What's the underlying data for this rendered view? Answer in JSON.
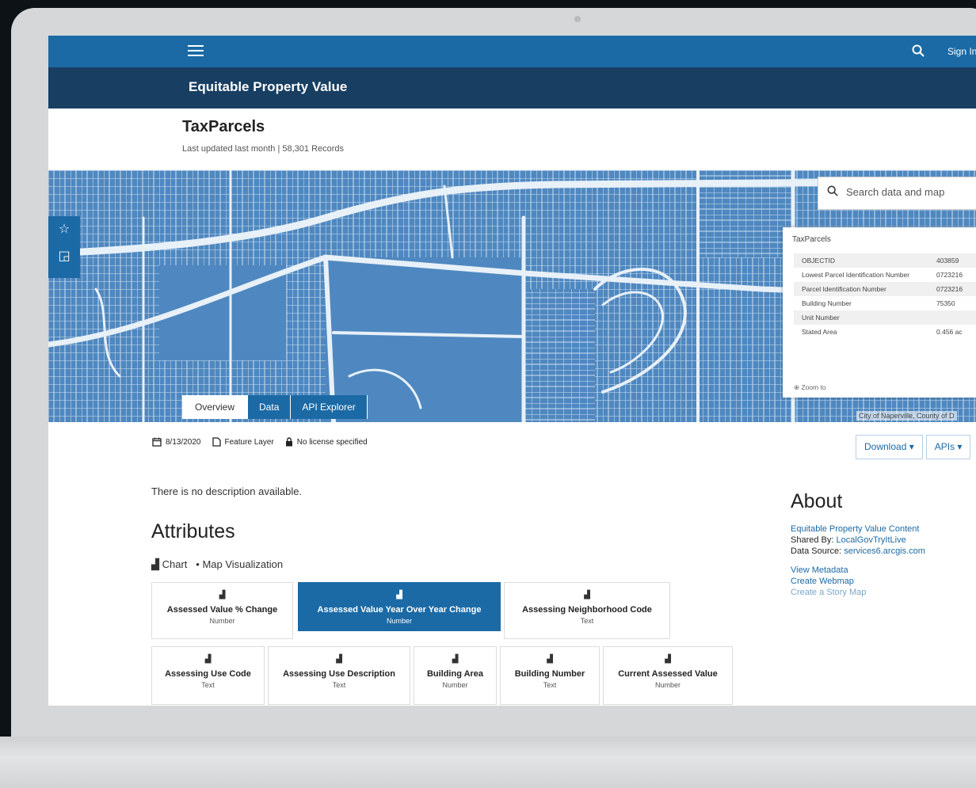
{
  "topbar": {
    "sign_in": "Sign In"
  },
  "site_title": "Equitable Property Value",
  "layer": {
    "name": "TaxParcels",
    "subtitle": "Last updated last month | 58,301 Records"
  },
  "map": {
    "search_placeholder": "Search data and map",
    "attribution": "City of Naperville, County of D",
    "popup": {
      "title": "TaxParcels",
      "rows": [
        {
          "field": "OBJECTID",
          "value": "403859"
        },
        {
          "field": "Lowest Parcel Identification Number",
          "value": "0723216"
        },
        {
          "field": "Parcel Identification Number",
          "value": "0723216"
        },
        {
          "field": "Building Number",
          "value": "75350"
        },
        {
          "field": "Unit Number",
          "value": ""
        },
        {
          "field": "Stated Area",
          "value": "0.456 ac"
        }
      ],
      "zoom_to": "Zoom to"
    }
  },
  "tabs": [
    "Overview",
    "Data",
    "API Explorer"
  ],
  "meta": {
    "date": "8/13/2020",
    "type": "Feature Layer",
    "license": "No license specified"
  },
  "buttons": {
    "download": "Download ▾",
    "apis": "APIs ▾"
  },
  "description": "There is no description available.",
  "attributes": {
    "heading": "Attributes",
    "legend_chart": "Chart",
    "legend_map": "Map Visualization",
    "cards": [
      {
        "label": "Assessed Value % Change",
        "type": "Number"
      },
      {
        "label": "Assessed Value Year Over Year Change",
        "type": "Number"
      },
      {
        "label": "Assessing Neighborhood Code",
        "type": "Text"
      },
      {
        "label": "Assessing Use Code",
        "type": "Text"
      },
      {
        "label": "Assessing Use Description",
        "type": "Text"
      },
      {
        "label": "Building Area",
        "type": "Number"
      },
      {
        "label": "Building Number",
        "type": "Text"
      },
      {
        "label": "Current Assessed Value",
        "type": "Number"
      }
    ]
  },
  "about": {
    "heading": "About",
    "content_link": "Equitable Property Value Content",
    "shared_by_label": "Shared By:",
    "shared_by": "LocalGovTryItLive",
    "source_label": "Data Source:",
    "source": "services6.arcgis.com",
    "view_metadata": "View Metadata",
    "create_webmap": "Create Webmap",
    "create_story_map": "Create a Story Map"
  },
  "colors": {
    "primary": "#1b6aa5",
    "header_dark": "#183f62",
    "map_fill": "#4f88c0"
  }
}
